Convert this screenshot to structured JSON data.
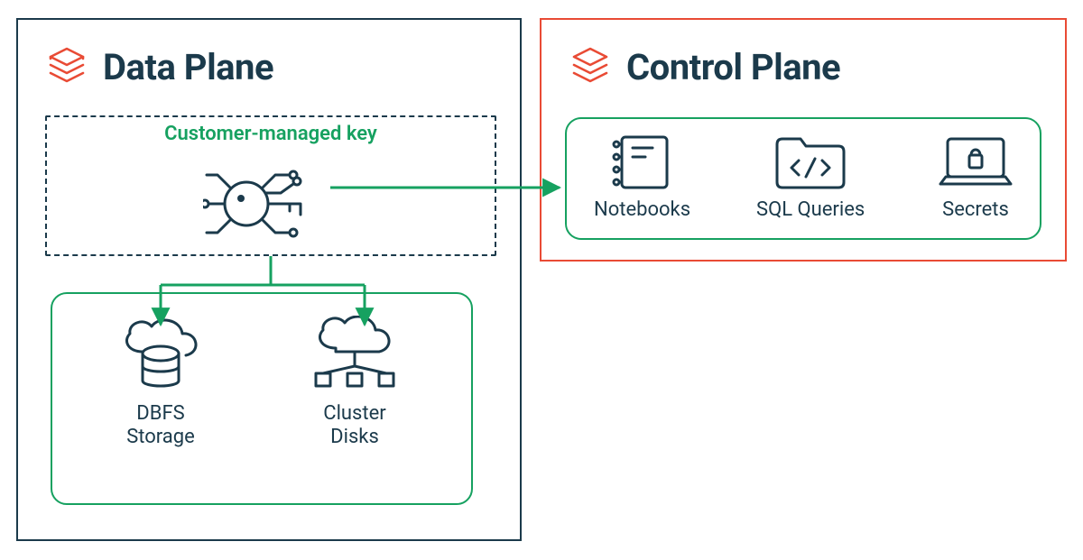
{
  "data_plane": {
    "title": "Data Plane",
    "cmk_label": "Customer-managed key",
    "resources": {
      "dbfs": "DBFS\nStorage",
      "cluster": "Cluster\nDisks"
    }
  },
  "control_plane": {
    "title": "Control Plane",
    "resources": {
      "notebooks": "Notebooks",
      "sql": "SQL Queries",
      "secrets": "Secrets"
    }
  },
  "colors": {
    "green": "#16a160",
    "orange": "#e94b35",
    "ink": "#1b3a4b"
  }
}
